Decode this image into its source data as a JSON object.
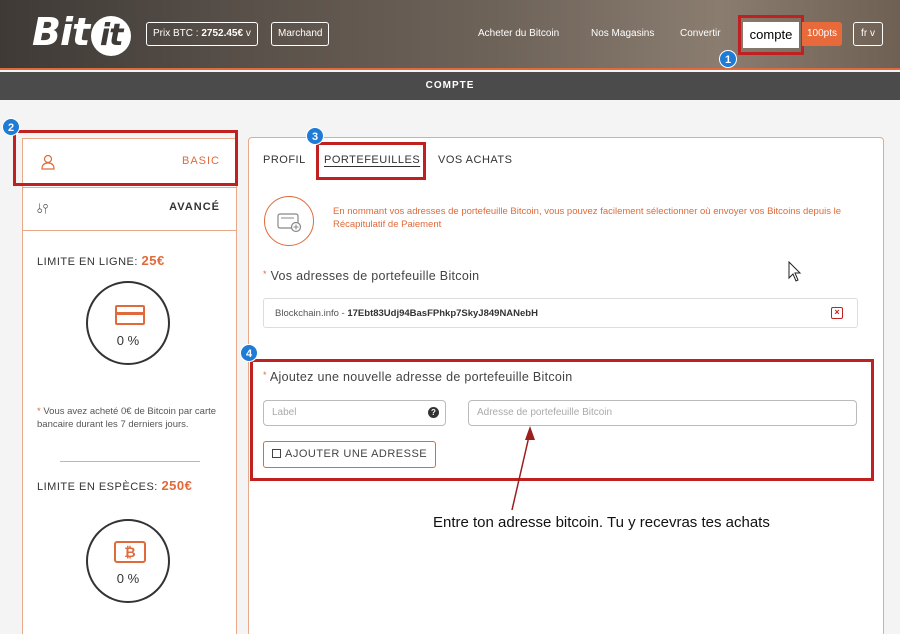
{
  "header": {
    "logo": "Bit",
    "logo_badge": "it",
    "price_label": "Prix BTC : ",
    "price_value": "2752.45€",
    "price_caret": "v",
    "marchand": "Marchand",
    "nav": [
      "Acheter du Bitcoin",
      "Nos Magasins",
      "Convertir"
    ],
    "compte": "compte",
    "points": "100pts",
    "lang": "fr"
  },
  "subheader": {
    "title": "COMPTE"
  },
  "badges": [
    "1",
    "2",
    "3",
    "4"
  ],
  "sidebar": {
    "basic": "BASIC",
    "avance": "AVANCÉ",
    "online_limit_label": "LIMITE EN LIGNE:",
    "online_limit_amount": "25€",
    "online_pct": "0 %",
    "online_note": "Vous avez acheté 0€ de Bitcoin par carte bancaire durant les 7 derniers jours.",
    "cash_limit_label": "LIMITE EN ESPÈCES:",
    "cash_limit_amount": "250€",
    "cash_pct": "0 %",
    "cash_symbol": "₿"
  },
  "tabs": [
    "PROFIL",
    "PORTEFEUILLES",
    "VOS ACHATS"
  ],
  "main": {
    "info": "En nommant vos adresses de portefeuille Bitcoin, vous pouvez facilement sélectionner où envoyer vos Bitcoins depuis le Récapitulatif de Paiement",
    "wallets_title": "Vos adresses de portefeuille Bitcoin",
    "wallet_label": "Blockchain.info",
    "wallet_sep": " - ",
    "wallet_address": "17Ebt83Udj94BasFPhkp7SkyJ849NANebH",
    "delete_glyph": "×",
    "add_title": "Ajoutez une nouvelle adresse de portefeuille Bitcoin",
    "label_placeholder": "Label",
    "label_help": "?",
    "address_placeholder": "Adresse de portefeuille Bitcoin",
    "add_button": "AJOUTER UNE ADRESSE"
  },
  "annotation": "Entre ton adresse bitcoin. Tu y recevras tes achats",
  "colors": {
    "accent": "#e06a3a",
    "highlight": "#c0201f",
    "badge": "#1e7bd6",
    "subbar": "#4b4b4b"
  }
}
